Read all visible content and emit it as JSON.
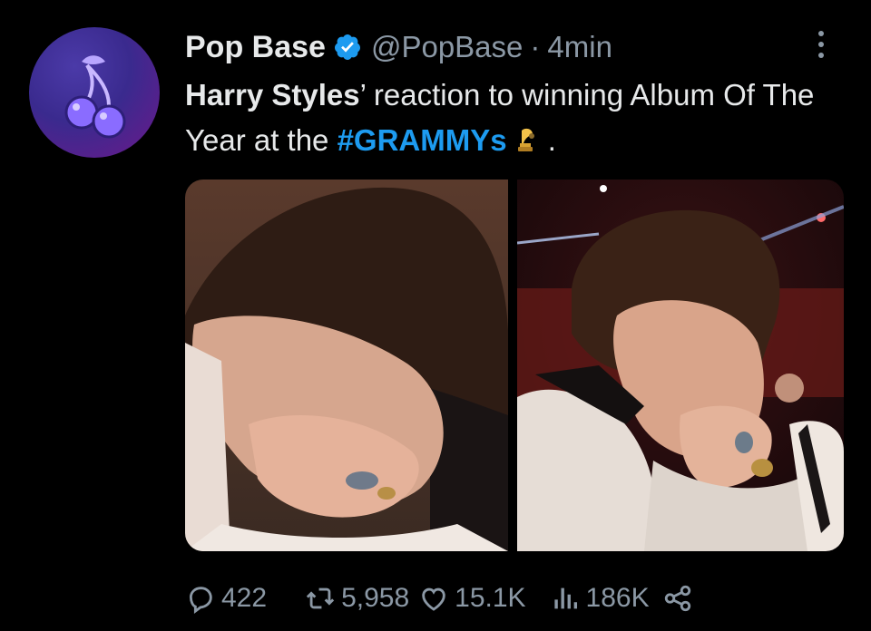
{
  "tweet": {
    "author": {
      "name": "Pop Base",
      "handle": "@PopBase",
      "separator": "·",
      "time": "4min",
      "avatar_icon": "cherries-icon",
      "verified_icon": "verified-badge-icon"
    },
    "text": {
      "part1_bold": "Harry Styles",
      "part2": "’ reaction to winning Album Of The Year at the ",
      "hashtag": "#GRAMMYs",
      "trailing": " ."
    },
    "media": [
      {
        "label": "photo-1"
      },
      {
        "label": "photo-2"
      }
    ],
    "metrics": {
      "replies": "422",
      "retweets": "5,958",
      "likes": "15.1K",
      "views": "186K"
    }
  },
  "colors": {
    "background": "#000000",
    "text": "#e7e9ea",
    "secondary": "#8b98a5",
    "accent": "#1d9bf0"
  }
}
